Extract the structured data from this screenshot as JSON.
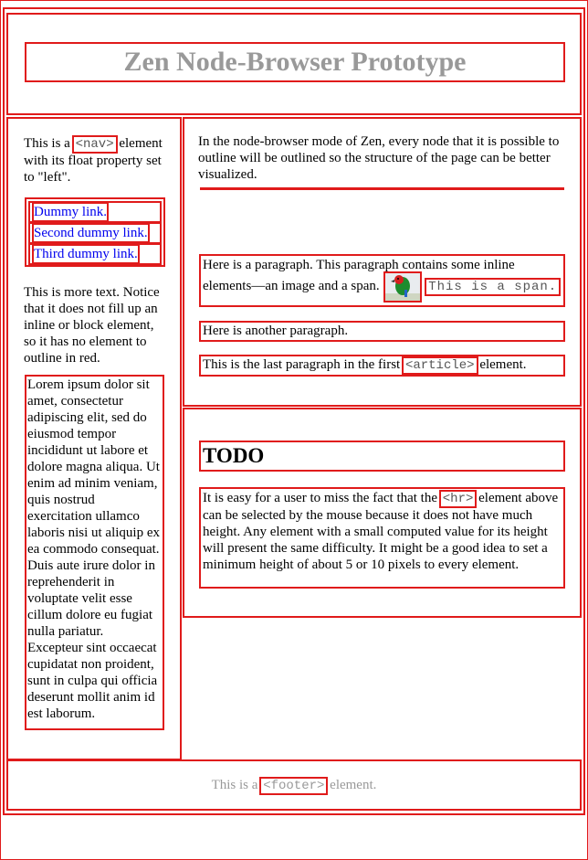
{
  "header": {
    "title": "Zen Node-Browser Prototype"
  },
  "nav": {
    "intro_prefix": "This is a",
    "intro_tag": "<nav>",
    "intro_suffix": "element with its float property set to \"left\".",
    "links": [
      "Dummy link.",
      "Second dummy link.",
      "Third dummy link."
    ],
    "more_text": "This is more text. Notice that it does not fill up an inline or block element, so it has no element to outline in red.",
    "lorem": "Lorem ipsum dolor sit amet, consectetur adipiscing elit, sed do eiusmod tempor incididunt ut labore et dolore magna aliqua. Ut enim ad minim veniam, quis nostrud exercitation ullamco laboris nisi ut aliquip ex ea commodo consequat. Duis aute irure dolor in reprehenderit in voluptate velit esse cillum dolore eu fugiat nulla pariatur. Excepteur sint occaecat cupidatat non proident, sunt in culpa qui officia deserunt mollit anim id est laborum."
  },
  "article1": {
    "intro": "In the node-browser mode of Zen, every node that it is possible to outline will be outlined so the structure of the page can be better visualized.",
    "para1_text": "Here is a paragraph. This paragraph contains some inline elements—an image and a span.",
    "para1_span": "This is a span.",
    "para2": "Here is another paragraph.",
    "para3_prefix": "This is the last paragraph in the first",
    "para3_tag": "<article>",
    "para3_suffix": "element."
  },
  "article2": {
    "heading": "TODO",
    "text_prefix": "It is easy for a user to miss the fact that the",
    "text_tag": "<hr>",
    "text_suffix": "element above can be selected by the mouse because it does not have much height. Any element with a small computed value for its height will present the same difficulty. It might be a good idea to set a minimum height of about 5 or 10 pixels to every element."
  },
  "footer": {
    "prefix": "This is a",
    "tag": "<footer>",
    "suffix": "element."
  },
  "colors": {
    "outline": "#e01b1b",
    "link": "#0000ee",
    "muted": "#999999"
  }
}
